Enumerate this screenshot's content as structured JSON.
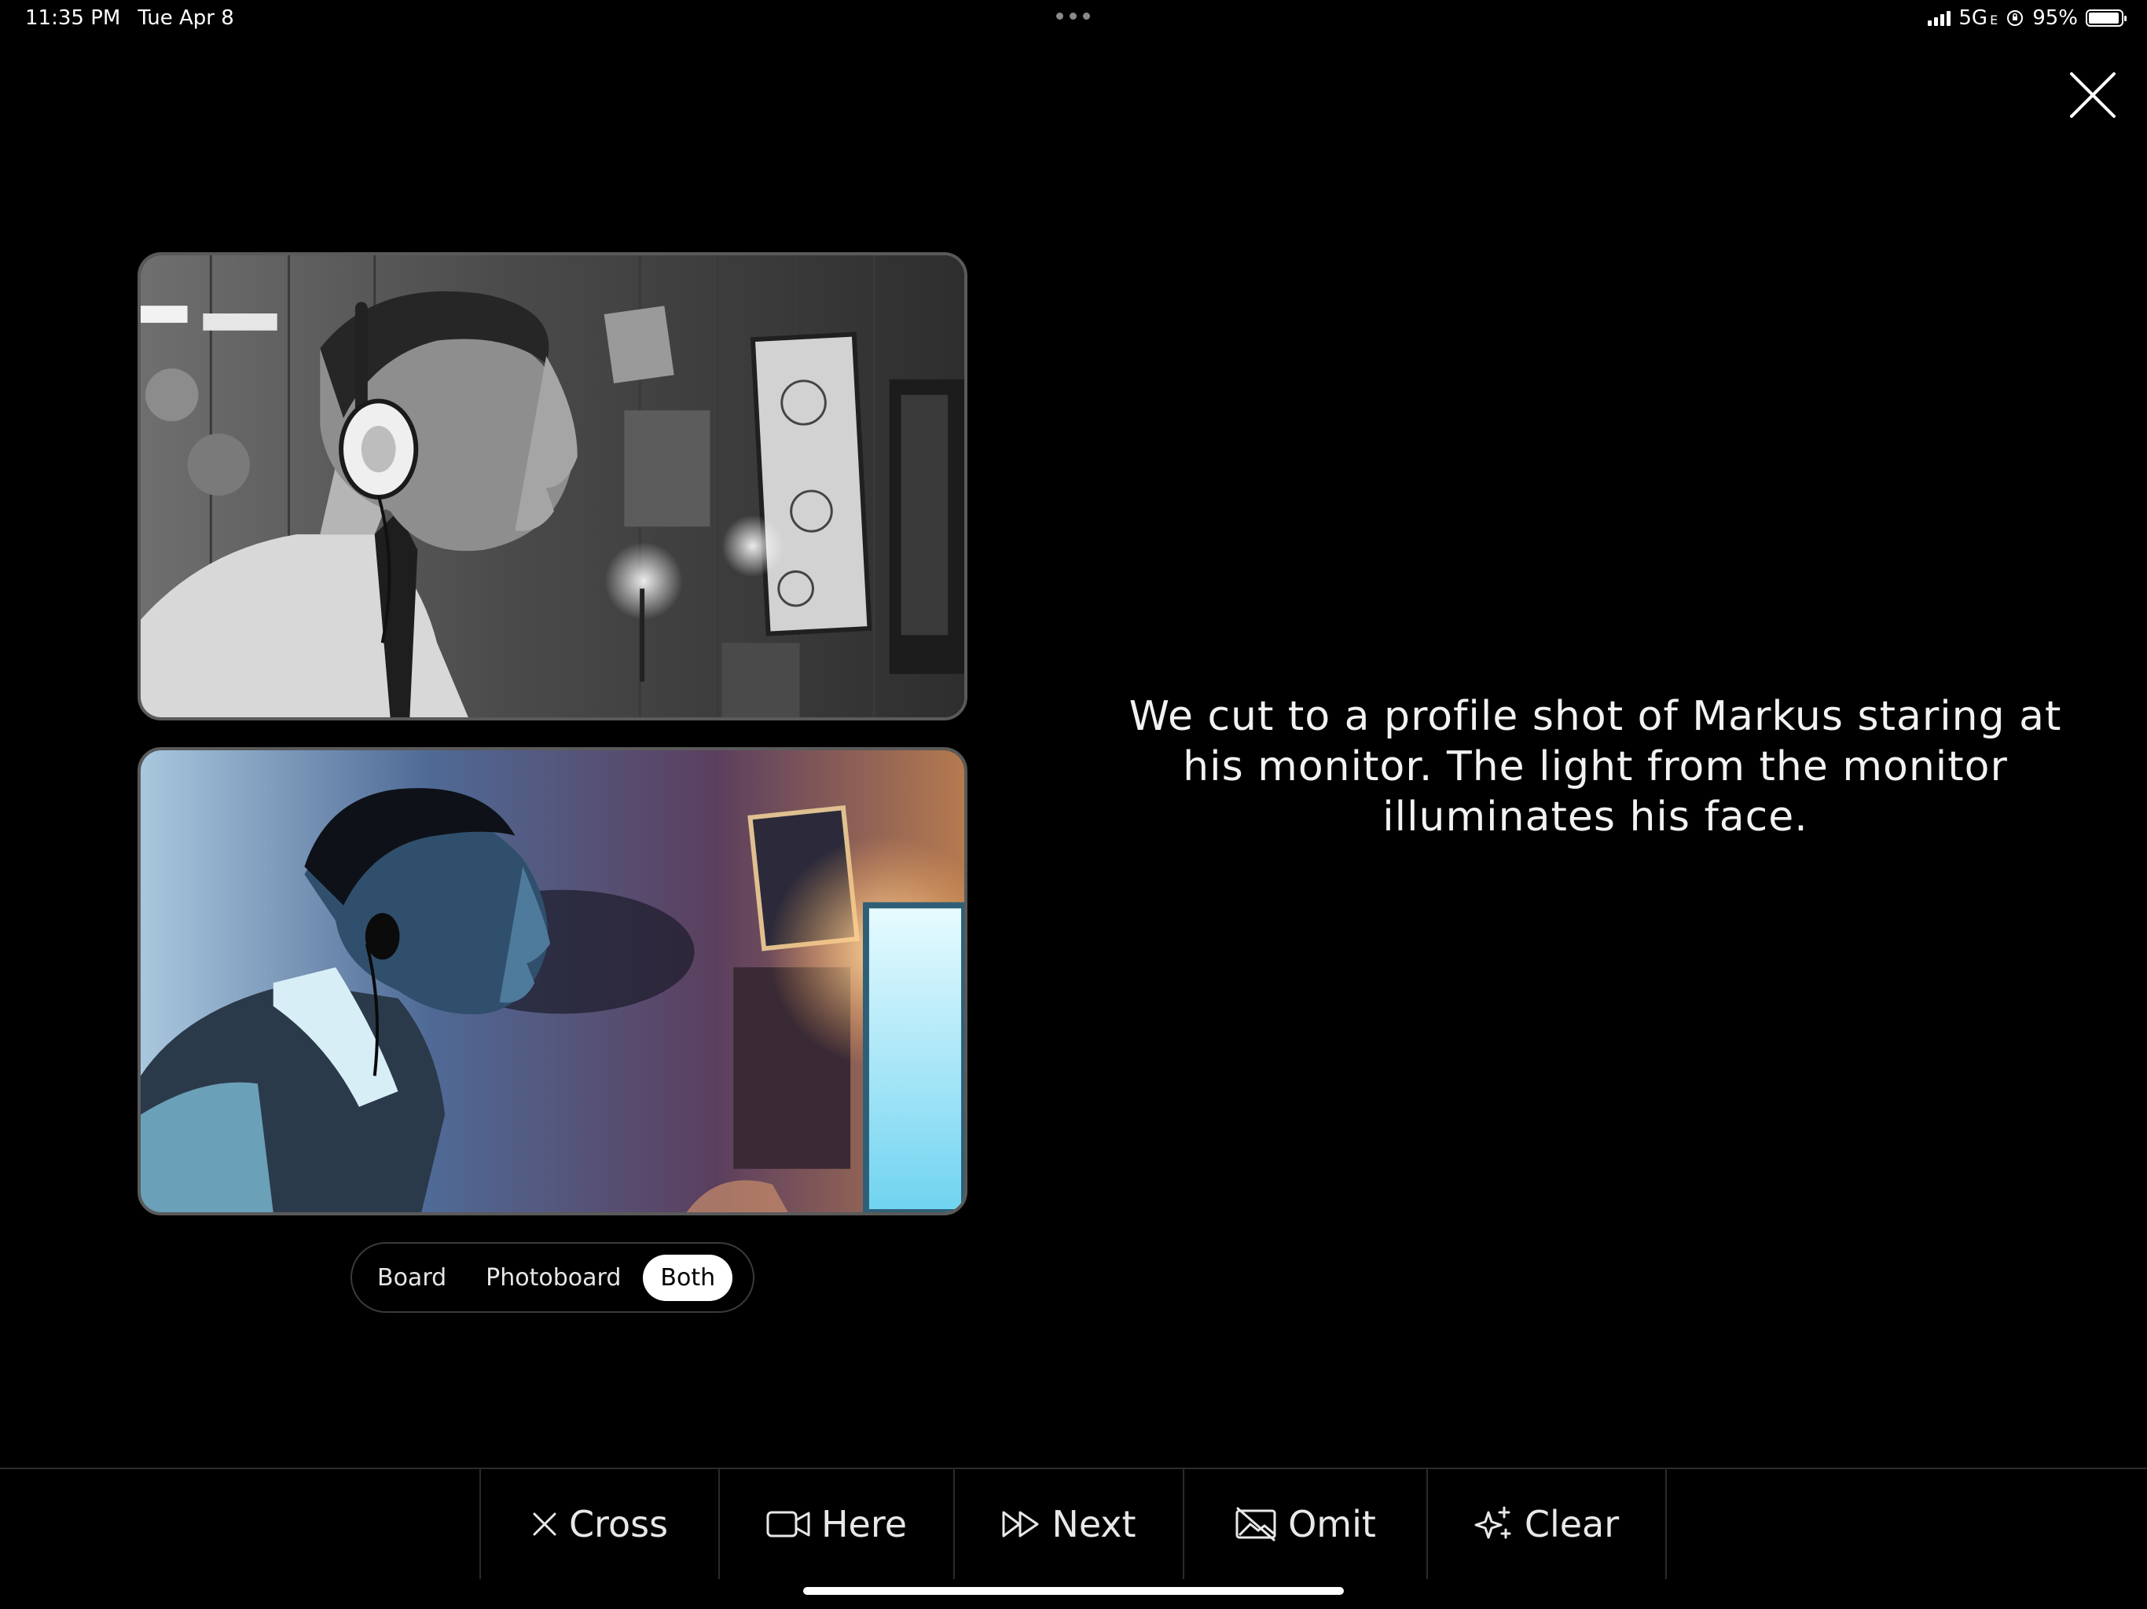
{
  "status_bar": {
    "time": "11:35 PM",
    "date": "Tue Apr 8",
    "network": "5G",
    "network_suffix": "E",
    "battery": "95%",
    "battery_level": 0.95
  },
  "close_icon": "close-icon",
  "images": {
    "board_image": "sketch-profile-markus-headphones",
    "photoboard_image": "photo-profile-markus-monitor"
  },
  "view_toggle": {
    "options": [
      "Board",
      "Photoboard",
      "Both"
    ],
    "selected": "Both"
  },
  "description": "We cut to a profile shot of Markus staring at his monitor. The light from the monitor illuminates his face.",
  "toolbar": {
    "items": [
      {
        "label": "Cross",
        "icon": "x-icon"
      },
      {
        "label": "Here",
        "icon": "video-camera-icon"
      },
      {
        "label": "Next",
        "icon": "fast-forward-icon"
      },
      {
        "label": "Omit",
        "icon": "image-off-icon"
      },
      {
        "label": "Clear",
        "icon": "sparkles-icon"
      }
    ]
  },
  "colors": {
    "background": "#000000",
    "text": "#ffffff",
    "panel_border": "#5a5a5a",
    "divider": "#2b2b2b"
  }
}
